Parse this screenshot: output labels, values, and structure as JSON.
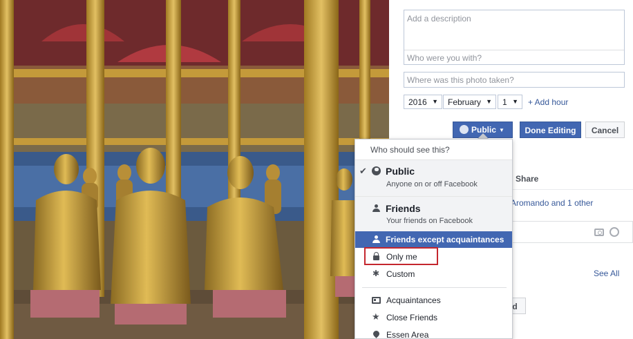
{
  "editor": {
    "description_placeholder": "Add a description",
    "with_placeholder": "Who were you with?",
    "location_placeholder": "Where was this photo taken?",
    "date": {
      "year": "2016",
      "month": "February",
      "day": "1"
    },
    "add_hour_label": "+ Add hour",
    "privacy_button_label": "Public",
    "done_button_label": "Done Editing",
    "cancel_button_label": "Cancel"
  },
  "background": {
    "share_label": "Share",
    "tagged_text": "Aromando and 1 other",
    "see_all_label": "See All",
    "friend_button_label": "nd"
  },
  "privacy_menu": {
    "header": "Who should see this?",
    "public": {
      "title": "Public",
      "subtitle": "Anyone on or off Facebook",
      "selected": true
    },
    "friends": {
      "title": "Friends",
      "subtitle": "Your friends on Facebook"
    },
    "friends_except": {
      "title": "Friends except acquaintances",
      "hovered": true
    },
    "only_me": {
      "label": "Only me",
      "highlighted": true
    },
    "custom": {
      "label": "Custom"
    },
    "lists": [
      "Acquaintances",
      "Close Friends",
      "Essen Area"
    ]
  },
  "colors": {
    "accent": "#4267b2",
    "link": "#365899",
    "highlight_border": "#c4262e"
  },
  "icons": {
    "check": "✔",
    "gear": "✱",
    "star": "★"
  }
}
